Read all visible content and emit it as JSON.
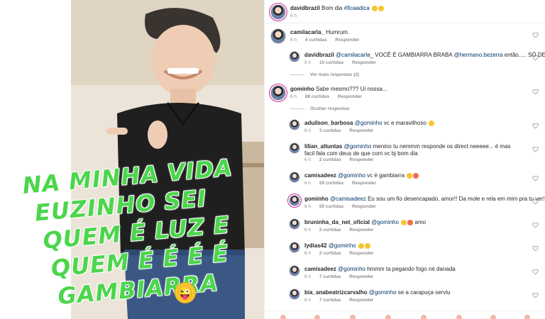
{
  "overlay": {
    "line1": "NA MINHA VIDA",
    "line2": "EUZINHO SEI",
    "line3": "QUEM É LUZ E",
    "line4": "QUEM É É É É",
    "line5": "GAMBIARRA",
    "wink_emoji": "😜"
  },
  "post": {
    "username": "davidbrazil",
    "caption": "Bom dia",
    "hashtag": "#ficaadica",
    "time": "6 h"
  },
  "comments": [
    {
      "user": "camilacarla_",
      "text": "Humrum.",
      "time": "6 h",
      "likes": "4 curtidas",
      "reply": "Responder"
    },
    {
      "user": "davidbrazil",
      "mention": "@camilacarla_",
      "text": "VOCÊ É GAMBIARRA BRABA",
      "mention2": "@hermano.bezerra",
      "text2": "então..... SÓ DEUS",
      "time": "5 h",
      "likes": "15 curtidas",
      "reply": "Responder"
    },
    {
      "view_more": "Ver mais respostas (2)"
    },
    {
      "user": "gominho",
      "text": "Sabe mesmo??? Ui nossa...",
      "time": "6 h",
      "likes": "88 curtidas",
      "reply": "Responder"
    },
    {
      "hide": "Ocultar respostas"
    },
    {
      "user": "aduilson_barbosa",
      "mention": "@gominho",
      "text": "vc e maravilhoso",
      "time": "6 h",
      "likes": "3 curtidas",
      "reply": "Responder"
    },
    {
      "user": "lilian_altuntas",
      "mention": "@gominho",
      "text": "menino tu nemmm responde os direct neeeee... è mas facil fala com deus de que com vc bj bom dia",
      "time": "6 h",
      "likes": "2 curtidas",
      "reply": "Responder"
    },
    {
      "user": "camisadeez",
      "mention": "@gominho",
      "text": "vc é gambiarra",
      "time": "6 h",
      "likes": "29 curtidas",
      "reply": "Responder"
    },
    {
      "user": "gominho",
      "mention": "@camisadeez",
      "text": "Eu sou um fio desencapado, amor!! Da mole e rela em mim pra tu ver!!!!",
      "time": "6 h",
      "likes": "50 curtidas",
      "reply": "Responder"
    },
    {
      "user": "bruninha_da_net_oficial",
      "mention": "@gominho",
      "text": "amo",
      "time": "6 h",
      "likes": "2 curtidas",
      "reply": "Responder"
    },
    {
      "user": "lydias42",
      "mention": "@gominho",
      "text": "",
      "time": "6 h",
      "likes": "2 curtidas",
      "reply": "Responder"
    },
    {
      "user": "camisadeez",
      "mention": "@gominho",
      "text": "hmmm ta pegando fogo né danada",
      "time": "6 h",
      "likes": "7 curtidas",
      "reply": "Responder"
    },
    {
      "user": "bia_anabeatrizcarvalho",
      "mention": "@gominho",
      "text": "se a carapuça serviu",
      "time": "6 h",
      "likes": "7 curtidas",
      "reply": "Responder"
    }
  ],
  "colors": {
    "overlay_green": "#4bd64b",
    "mention_blue": "#003569",
    "meta_gray": "#8e8e8e"
  },
  "icons": {
    "like": "heart-outline-icon"
  }
}
